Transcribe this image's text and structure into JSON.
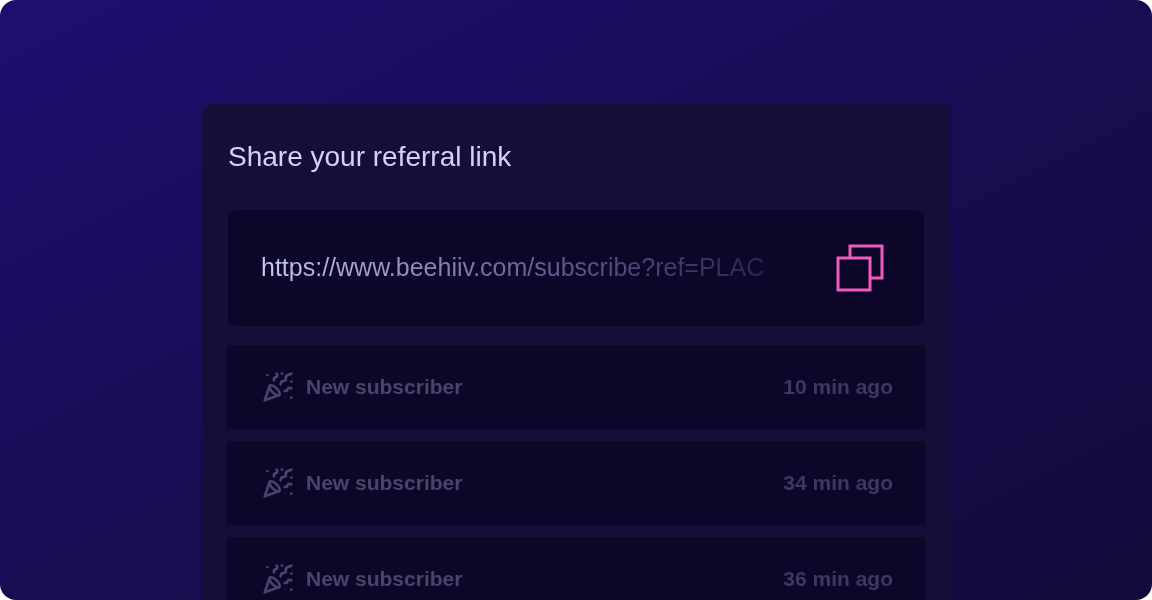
{
  "title": "Share your referral link",
  "link": {
    "url": "https://www.beehiiv.com/subscribe?ref=PLAC"
  },
  "events": [
    {
      "label": "New subscriber",
      "time": "10 min ago"
    },
    {
      "label": "New subscriber",
      "time": "34 min ago"
    },
    {
      "label": "New subscriber",
      "time": "36 min ago"
    }
  ]
}
